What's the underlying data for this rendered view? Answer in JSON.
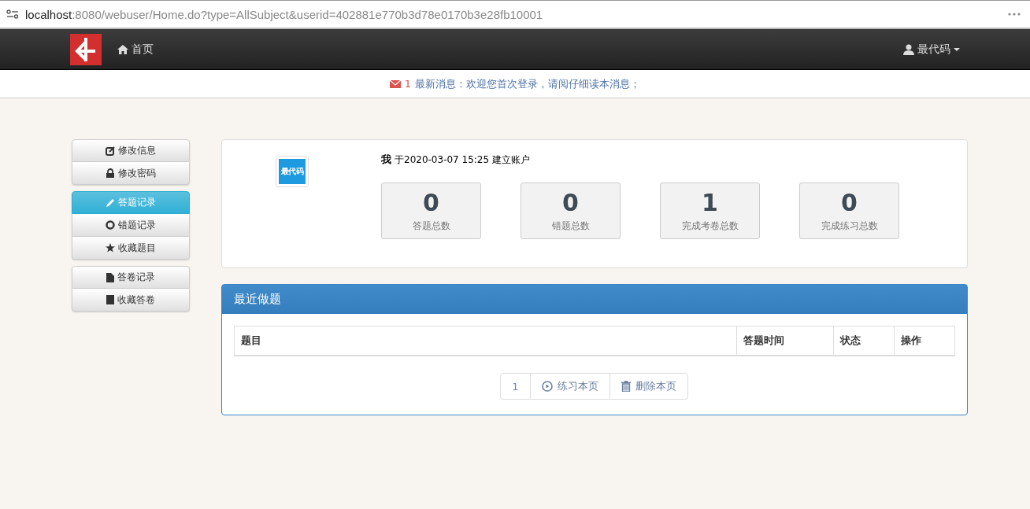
{
  "browser": {
    "url_host": "localhost",
    "url_path": ":8080/webuser/Home.do?type=AllSubject&userid=402881e770b3d78e0170b3e28fb10001"
  },
  "navbar": {
    "home": "首页",
    "user": "最代码"
  },
  "notice": {
    "count": "1",
    "text": "最新消息：欢迎您首次登录，请阅仔细读本消息；"
  },
  "sidebar": {
    "groups": [
      [
        {
          "label": "修改信息",
          "kind": "edit",
          "selected": false
        },
        {
          "label": "修改密码",
          "kind": "lock",
          "selected": false
        }
      ],
      [
        {
          "label": "答题记录",
          "kind": "pencil",
          "selected": true
        },
        {
          "label": "错题记录",
          "kind": "ring",
          "selected": false
        },
        {
          "label": "收藏题目",
          "kind": "star",
          "selected": false
        }
      ],
      [
        {
          "label": "答卷记录",
          "kind": "file",
          "selected": false
        },
        {
          "label": "收藏答卷",
          "kind": "book",
          "selected": false
        }
      ]
    ]
  },
  "profile": {
    "avatar_text": "最代码",
    "name": "我",
    "created": "于2020-03-07 15:25 建立账户",
    "stats": [
      {
        "value": "0",
        "label": "答题总数"
      },
      {
        "value": "0",
        "label": "错题总数"
      },
      {
        "value": "1",
        "label": "完成考卷总数"
      },
      {
        "value": "0",
        "label": "完成练习总数"
      }
    ]
  },
  "recent": {
    "title": "最近做题",
    "columns": [
      "题目",
      "答题时间",
      "状态",
      "操作"
    ],
    "pager": {
      "page": "1",
      "practice": "练习本页",
      "delete": "删除本页"
    }
  }
}
